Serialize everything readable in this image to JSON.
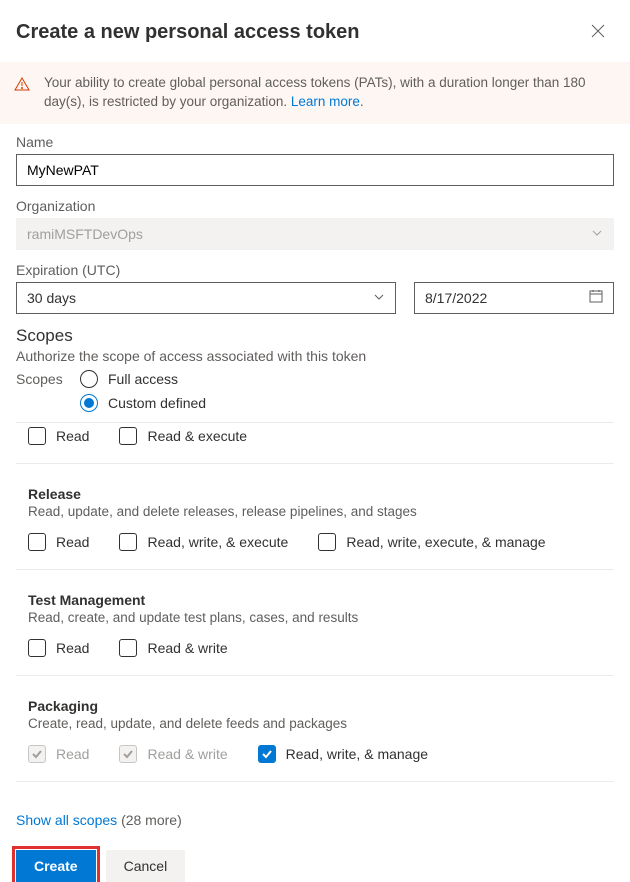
{
  "header": {
    "title": "Create a new personal access token"
  },
  "warning": {
    "text_prefix": "Your ability to create global personal access tokens (PATs), with a duration longer than 180 day(s), is restricted by your organization. ",
    "learn_more": "Learn more",
    "dot": "."
  },
  "fields": {
    "name_label": "Name",
    "name_value": "MyNewPAT",
    "org_label": "Organization",
    "org_value": "ramiMSFTDevOps",
    "expiration_label": "Expiration (UTC)",
    "expiration_preset": "30 days",
    "expiration_date": "8/17/2022"
  },
  "scopes": {
    "heading": "Scopes",
    "sub": "Authorize the scope of access associated with this token",
    "radio_label": "Scopes",
    "options": {
      "full": "Full access",
      "custom": "Custom defined"
    },
    "selected": "custom"
  },
  "scope_groups": [
    {
      "id": "partial-top",
      "title": "",
      "desc": "",
      "partial": true,
      "perms": [
        {
          "label": "Read",
          "state": "unchecked"
        },
        {
          "label": "Read & execute",
          "state": "unchecked"
        }
      ]
    },
    {
      "id": "release",
      "title": "Release",
      "desc": "Read, update, and delete releases, release pipelines, and stages",
      "perms": [
        {
          "label": "Read",
          "state": "unchecked"
        },
        {
          "label": "Read, write, & execute",
          "state": "unchecked"
        },
        {
          "label": "Read, write, execute, & manage",
          "state": "unchecked"
        }
      ]
    },
    {
      "id": "test",
      "title": "Test Management",
      "desc": "Read, create, and update test plans, cases, and results",
      "perms": [
        {
          "label": "Read",
          "state": "unchecked"
        },
        {
          "label": "Read & write",
          "state": "unchecked"
        }
      ]
    },
    {
      "id": "packaging",
      "title": "Packaging",
      "desc": "Create, read, update, and delete feeds and packages",
      "perms": [
        {
          "label": "Read",
          "state": "disabled-checked"
        },
        {
          "label": "Read & write",
          "state": "disabled-checked"
        },
        {
          "label": "Read, write, & manage",
          "state": "checked"
        }
      ]
    }
  ],
  "show_more": {
    "link": "Show all scopes",
    "count": "(28 more)"
  },
  "buttons": {
    "create": "Create",
    "cancel": "Cancel"
  }
}
